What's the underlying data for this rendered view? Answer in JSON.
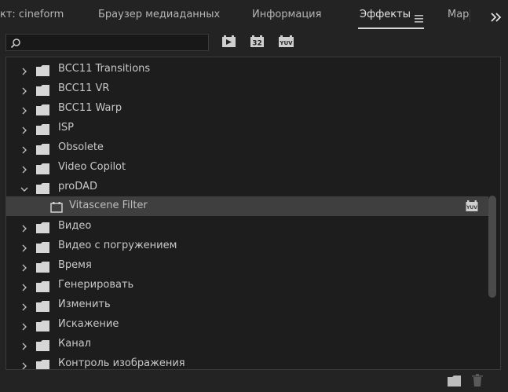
{
  "tabs": [
    {
      "label": "кт: cineform"
    },
    {
      "label": "Браузер медиаданных"
    },
    {
      "label": "Информация"
    },
    {
      "label": "Эффекты"
    },
    {
      "label": "Мар"
    }
  ],
  "search": {
    "value": "",
    "placeholder": ""
  },
  "toolbar_icons": [
    "accelerated-effects-icon",
    "32-bit-color-icon",
    "yuv-effects-icon"
  ],
  "tree": [
    {
      "label": "BCC11 Transitions",
      "expanded": false
    },
    {
      "label": "BCC11 VR",
      "expanded": false
    },
    {
      "label": "BCC11 Warp",
      "expanded": false
    },
    {
      "label": "ISP",
      "expanded": false
    },
    {
      "label": "Obsolete",
      "expanded": false
    },
    {
      "label": "Video Copilot",
      "expanded": false
    },
    {
      "label": "proDAD",
      "expanded": true
    },
    {
      "label": "Vitascene Filter",
      "selected": true,
      "child": true
    },
    {
      "label": "Видео",
      "expanded": false
    },
    {
      "label": "Видео с погружением",
      "expanded": false
    },
    {
      "label": "Время",
      "expanded": false
    },
    {
      "label": "Генерировать",
      "expanded": false
    },
    {
      "label": "Изменить",
      "expanded": false
    },
    {
      "label": "Искажение",
      "expanded": false
    },
    {
      "label": "Канал",
      "expanded": false
    },
    {
      "label": "Контроль изображения",
      "expanded": false
    }
  ],
  "colors": {
    "background": "#232323",
    "panel": "#1d1d1d",
    "selected_row": "#3f3f3f",
    "text": "#c9c9c9",
    "icon": "#d0d0d0"
  }
}
